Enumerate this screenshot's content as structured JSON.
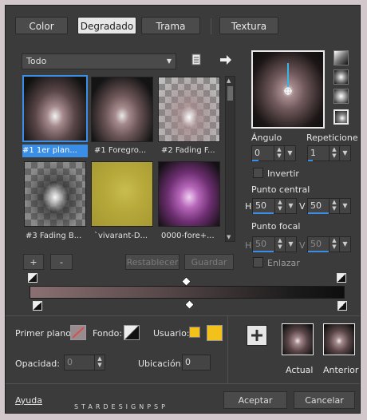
{
  "tabs": [
    {
      "label": "Color"
    },
    {
      "label": "Degradado"
    },
    {
      "label": "Trama"
    },
    {
      "label": "Textura"
    }
  ],
  "category": {
    "value": "Todo"
  },
  "thumbnails": [
    {
      "label": "#1 1er plan..."
    },
    {
      "label": "#1 Foregro..."
    },
    {
      "label": "#2 Fading F..."
    },
    {
      "label": "#3 Fading B..."
    },
    {
      "label": "`vivarant-D..."
    },
    {
      "label": "0000-fore+..."
    }
  ],
  "list_buttons": {
    "add": "+",
    "remove": "-",
    "reset": "Restablecer",
    "save": "Guardar"
  },
  "angle": {
    "label": "Ángulo",
    "value": "0"
  },
  "repeat": {
    "label": "Repeticione",
    "value": "1"
  },
  "invert": {
    "label": "Invertir",
    "checked": false
  },
  "center": {
    "label": "Punto central",
    "h_label": "H",
    "h": "50",
    "v_label": "V",
    "v": "50"
  },
  "focal": {
    "label": "Punto focal",
    "h_label": "H",
    "h": "50",
    "v_label": "V",
    "v": "50"
  },
  "link": {
    "label": "Enlazar",
    "checked": false
  },
  "bottom": {
    "foreground_label": "Primer plano:",
    "background_label": "Fondo:",
    "user_label": "Usuario:",
    "opacity_label": "Opacidad:",
    "opacity_value": "0",
    "location_label": "Ubicación:",
    "location_value": "0",
    "current_label": "Actual",
    "previous_label": "Anterior"
  },
  "footer": {
    "help": "Ayuda",
    "accept": "Aceptar",
    "cancel": "Cancelar",
    "watermark": "STARDESIGNPSP"
  },
  "colors": {
    "accent": "#3a8ee6",
    "user_color": "#f2c21b",
    "background": "#3b3b3b"
  },
  "icons": [
    "document-icon",
    "arrow-right-icon",
    "linear-style-icon",
    "rectangular-style-icon",
    "sunburst-style-icon",
    "radial-style-icon",
    "plus-icon"
  ]
}
